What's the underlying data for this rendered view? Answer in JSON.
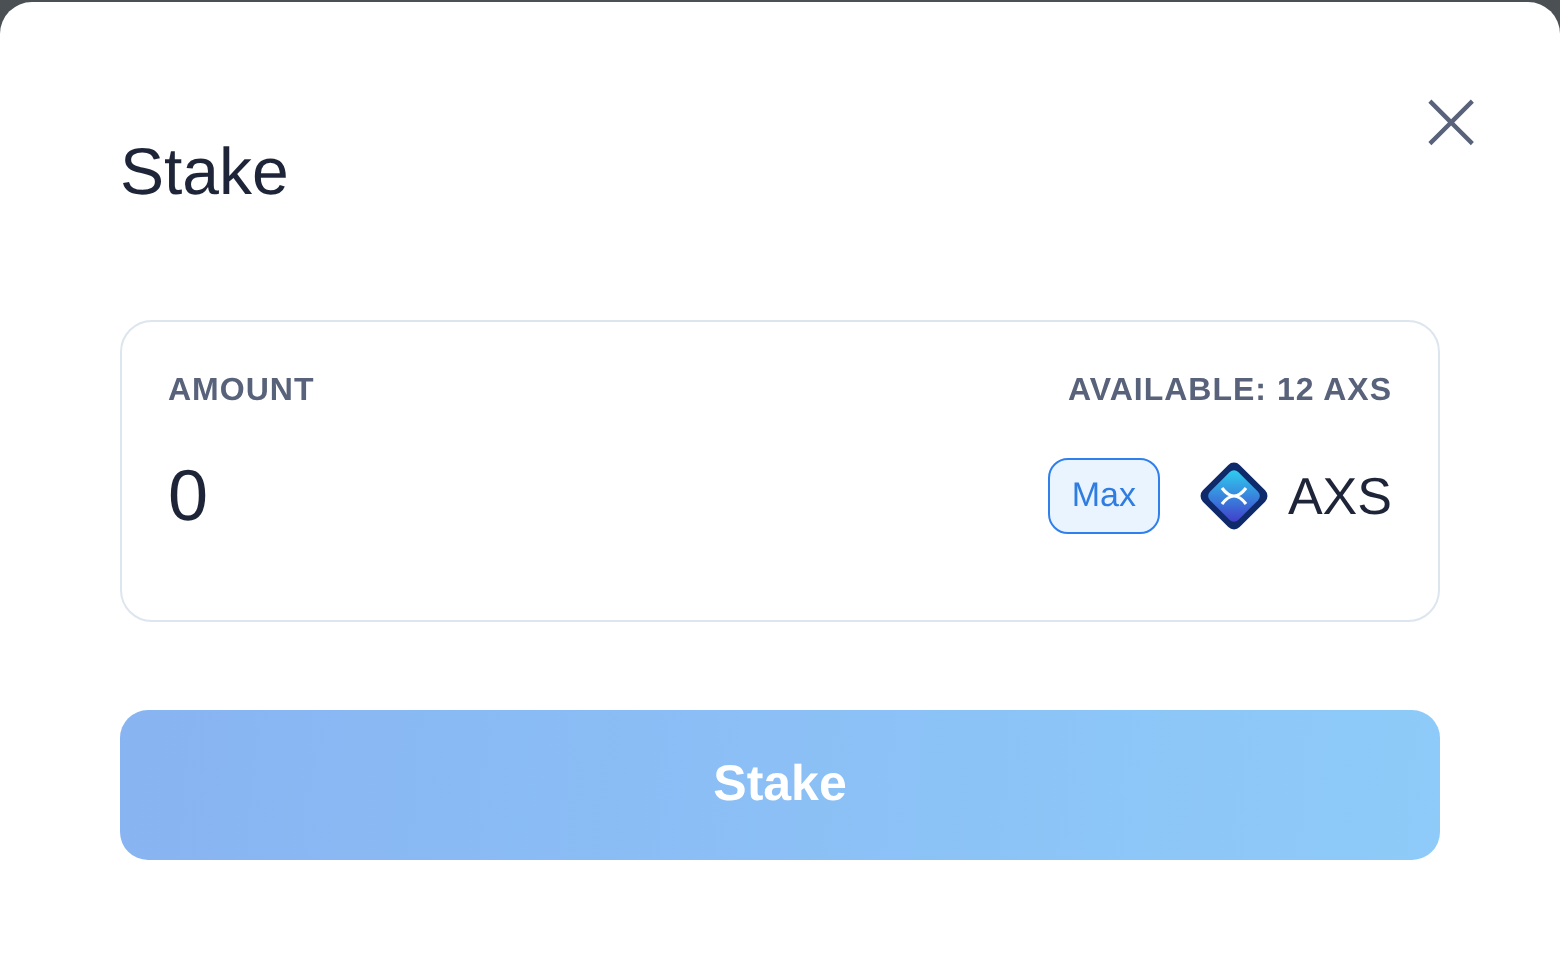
{
  "dialog": {
    "title": "Stake",
    "close": "×"
  },
  "amount": {
    "label": "AMOUNT",
    "available": "AVAILABLE: 12 AXS",
    "value": "0",
    "max_button": "Max",
    "token": "AXS"
  },
  "submit": {
    "label": "Stake",
    "disabled": true
  }
}
